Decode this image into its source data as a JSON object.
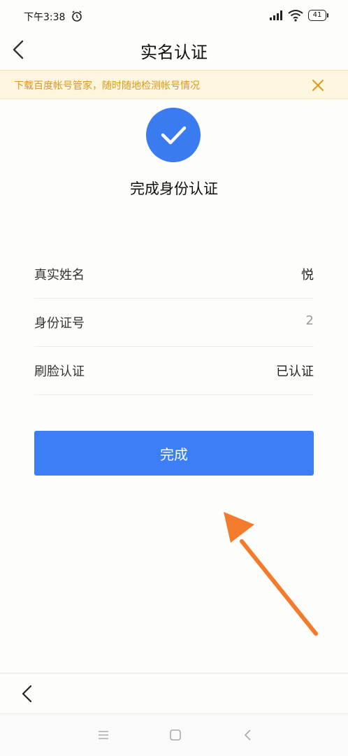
{
  "status_bar": {
    "time": "下午3:38",
    "battery": "41"
  },
  "header": {
    "title": "实名认证"
  },
  "notice": {
    "text": "下载百度帐号管家，随时随地检测帐号情况"
  },
  "result": {
    "title": "完成身份认证"
  },
  "info": {
    "rows": [
      {
        "label": "真实姓名",
        "value": "悦"
      },
      {
        "label": "身份证号",
        "value": "2"
      },
      {
        "label": "刷脸认证",
        "value": "已认证"
      }
    ]
  },
  "actions": {
    "done_label": "完成"
  },
  "colors": {
    "primary": "#3b7ef5",
    "notice_bg": "#fdf5dd",
    "notice_text": "#d99a1a",
    "arrow": "#f47a2c"
  },
  "icons": {
    "alarm": "alarm-clock-icon",
    "signal": "signal-icon",
    "wifi": "wifi-icon",
    "back": "chevron-left-icon",
    "close": "close-icon",
    "check": "check-icon",
    "menu": "menu-icon",
    "home": "square-icon"
  }
}
